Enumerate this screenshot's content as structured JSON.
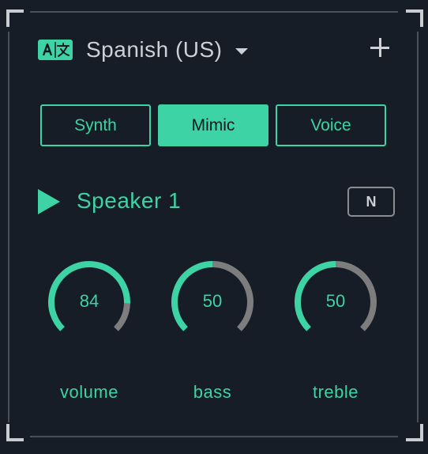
{
  "header": {
    "language": "Spanish (US)",
    "language_icon": "translate-icon",
    "add_icon": "plus-icon"
  },
  "tabs": [
    {
      "label": "Synth",
      "active": false
    },
    {
      "label": "Mimic",
      "active": true
    },
    {
      "label": "Voice",
      "active": false
    }
  ],
  "speaker": {
    "name": "Speaker 1",
    "play_icon": "play-icon",
    "badge_label": "N"
  },
  "knobs": [
    {
      "label": "volume",
      "value": 84
    },
    {
      "label": "bass",
      "value": 50
    },
    {
      "label": "treble",
      "value": 50
    }
  ],
  "colors": {
    "accent": "#3dd3a5",
    "background": "#171d26",
    "track": "#7d7d7d",
    "text": "#cdd1d6"
  }
}
